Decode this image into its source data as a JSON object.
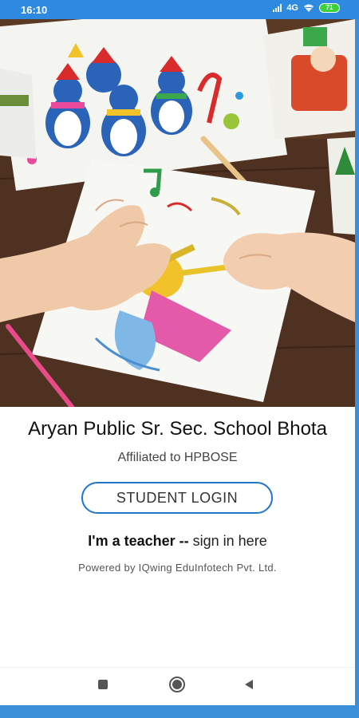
{
  "status_bar": {
    "time": "16:10",
    "network": "4G",
    "battery": "71",
    "colors": {
      "background": "#2d8ae0",
      "battery": "#3bd13b"
    },
    "icons": [
      "signal-icon",
      "wifi-icon",
      "battery-icon"
    ]
  },
  "hero": {
    "icon": "children-coloring-illustration"
  },
  "school": {
    "name": "Aryan Public Sr. Sec. School Bhota",
    "affiliation": "Affiliated to HPBOSE"
  },
  "login": {
    "student_button": "STUDENT LOGIN",
    "teacher_prefix": "I'm a teacher --",
    "teacher_link": "sign in here",
    "accent_color": "#2176c8"
  },
  "footer": {
    "powered_by": "Powered by IQwing EduInfotech Pvt. Ltd."
  },
  "nav": {
    "icons": [
      "recents-icon",
      "home-icon",
      "back-icon"
    ]
  }
}
